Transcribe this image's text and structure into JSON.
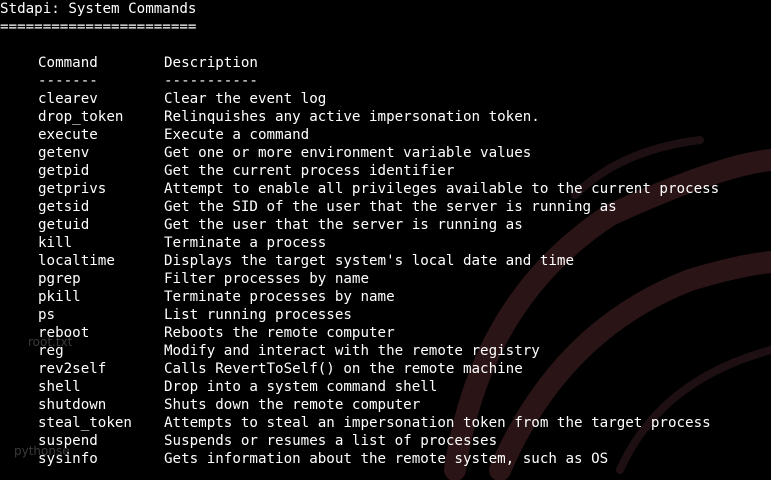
{
  "terminal": {
    "section_title": "Stdapi: System Commands",
    "section_underline": "=======================",
    "header_command": "Command",
    "header_description": "Description",
    "header_command_underline": "-------",
    "header_description_underline": "-----------"
  },
  "commands": [
    {
      "name": "clearev",
      "description": "Clear the event log"
    },
    {
      "name": "drop_token",
      "description": "Relinquishes any active impersonation token."
    },
    {
      "name": "execute",
      "description": "Execute a command"
    },
    {
      "name": "getenv",
      "description": "Get one or more environment variable values"
    },
    {
      "name": "getpid",
      "description": "Get the current process identifier"
    },
    {
      "name": "getprivs",
      "description": "Attempt to enable all privileges available to the current process"
    },
    {
      "name": "getsid",
      "description": "Get the SID of the user that the server is running as"
    },
    {
      "name": "getuid",
      "description": "Get the user that the server is running as"
    },
    {
      "name": "kill",
      "description": "Terminate a process"
    },
    {
      "name": "localtime",
      "description": "Displays the target system's local date and time"
    },
    {
      "name": "pgrep",
      "description": "Filter processes by name"
    },
    {
      "name": "pkill",
      "description": "Terminate processes by name"
    },
    {
      "name": "ps",
      "description": "List running processes"
    },
    {
      "name": "reboot",
      "description": "Reboots the remote computer"
    },
    {
      "name": "reg",
      "description": "Modify and interact with the remote registry"
    },
    {
      "name": "rev2self",
      "description": "Calls RevertToSelf() on the remote machine"
    },
    {
      "name": "shell",
      "description": "Drop into a system command shell"
    },
    {
      "name": "shutdown",
      "description": "Shuts down the remote computer"
    },
    {
      "name": "steal_token",
      "description": "Attempts to steal an impersonation token from the target process"
    },
    {
      "name": "suspend",
      "description": "Suspends or resumes a list of processes"
    },
    {
      "name": "sysinfo",
      "description": "Gets information about the remote system, such as OS"
    }
  ],
  "desktop": {
    "icon_label_1": "root.txt",
    "icon_label_2": "pythonse"
  },
  "colors": {
    "background": "#000000",
    "text": "#ffffff",
    "wallpaper_mark": "#2a1416"
  }
}
